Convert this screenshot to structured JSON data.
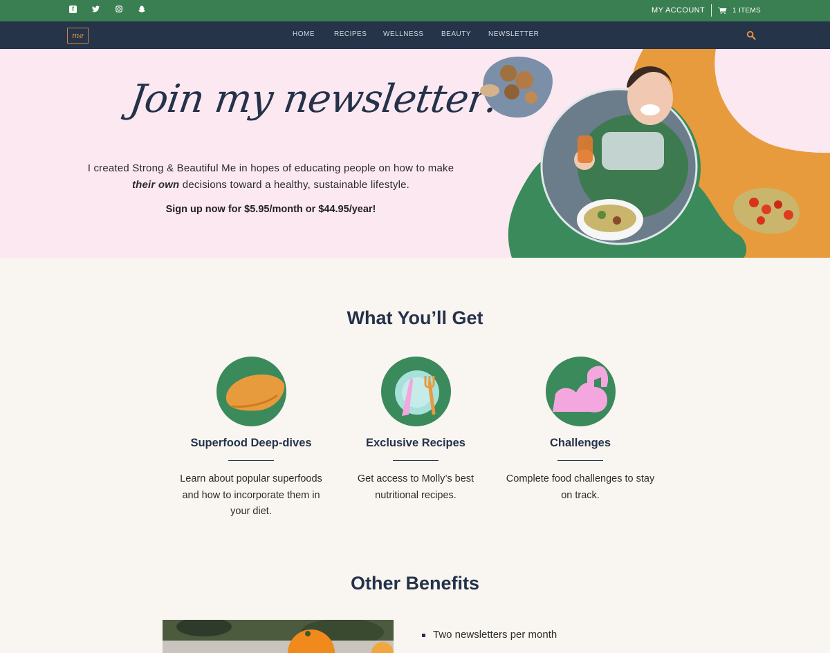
{
  "topbar": {
    "social_icons": [
      "facebook-icon",
      "twitter-icon",
      "instagram-icon",
      "snapchat-icon"
    ],
    "account_label": "MY ACCOUNT",
    "cart_label": "1 ITEMS"
  },
  "nav": {
    "logo_text": "me",
    "items": [
      "HOME",
      "RECIPES",
      "WELLNESS",
      "BEAUTY",
      "NEWSLETTER"
    ]
  },
  "hero": {
    "title": "Join my newsletter!",
    "intro_before": "I created Strong & Beautiful Me in hopes of educating people on how to make ",
    "intro_emphasis": "their own",
    "intro_after": " decisions toward a healthy, sustainable lifestyle.",
    "offer": "Sign up now for $5.95/month or $44.95/year!"
  },
  "get": {
    "title": "What You’ll Get",
    "features": [
      {
        "icon": "sweet-potato-icon",
        "title": "Superfood Deep-dives",
        "text": "Learn about popular superfoods and how to incorporate them in your diet."
      },
      {
        "icon": "plate-fork-knife-icon",
        "title": "Exclusive Recipes",
        "text": "Get access to Molly’s best nutritional recipes."
      },
      {
        "icon": "flexed-arm-icon",
        "title": "Challenges",
        "text": "Complete food challenges to stay on track."
      }
    ]
  },
  "benefits": {
    "title": "Other Benefits",
    "items": [
      "Two newsletters per month"
    ]
  },
  "colors": {
    "topbar_green": "#3a7f52",
    "nav_navy": "#263449",
    "hero_pink": "#fce8f1",
    "accent_orange": "#e89b3c",
    "icon_green": "#3a8a5c",
    "page_cream": "#f9f5f0"
  }
}
